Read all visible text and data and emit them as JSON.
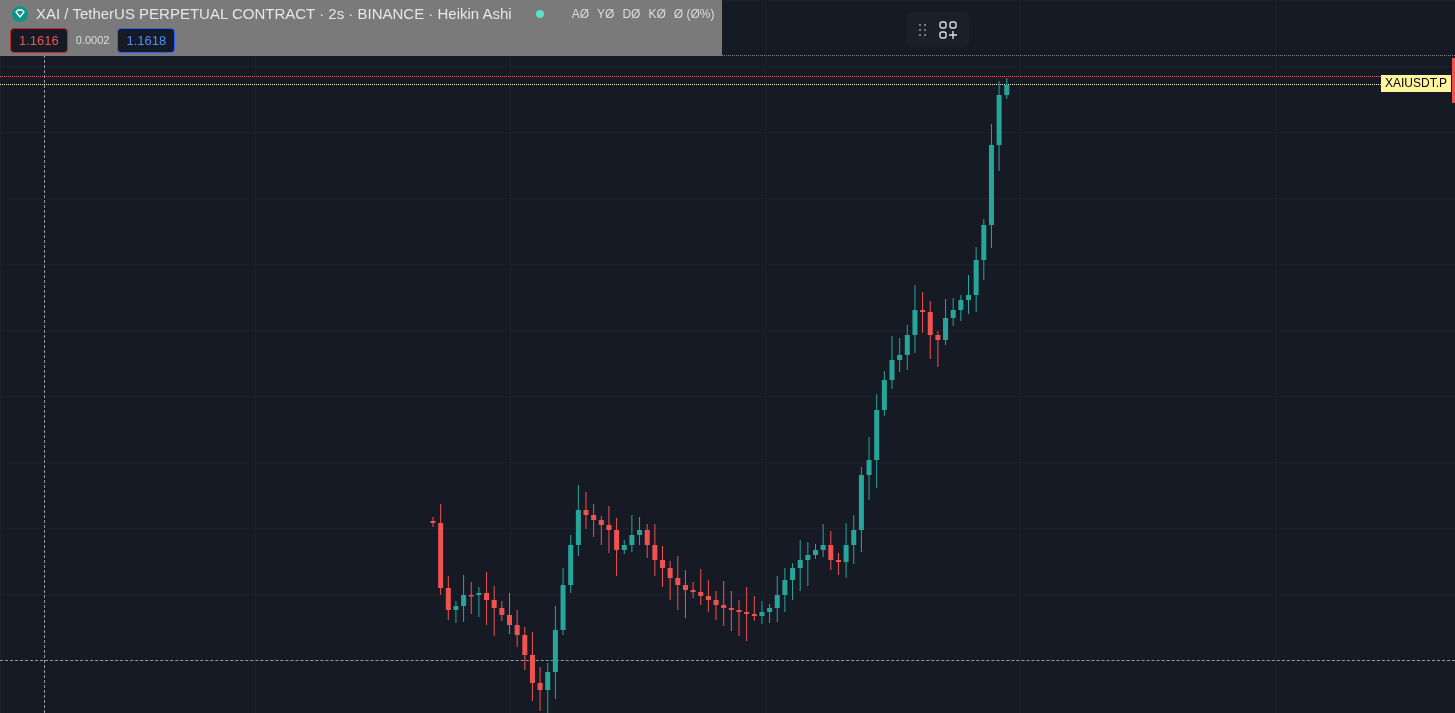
{
  "legend": {
    "title": "XAI / TetherUS PERPETUAL CONTRACT · 2s · BINANCE · Heikin Ashi",
    "status": {
      "color": "#5ce0c6"
    },
    "values": [
      "AØ",
      "YØ",
      "DØ",
      "KØ",
      "Ø (Ø%)"
    ]
  },
  "quote": {
    "bid": "1.1616",
    "spread": "0.0002",
    "ask": "1.1618"
  },
  "price_label": "XAIUSDT.P"
}
